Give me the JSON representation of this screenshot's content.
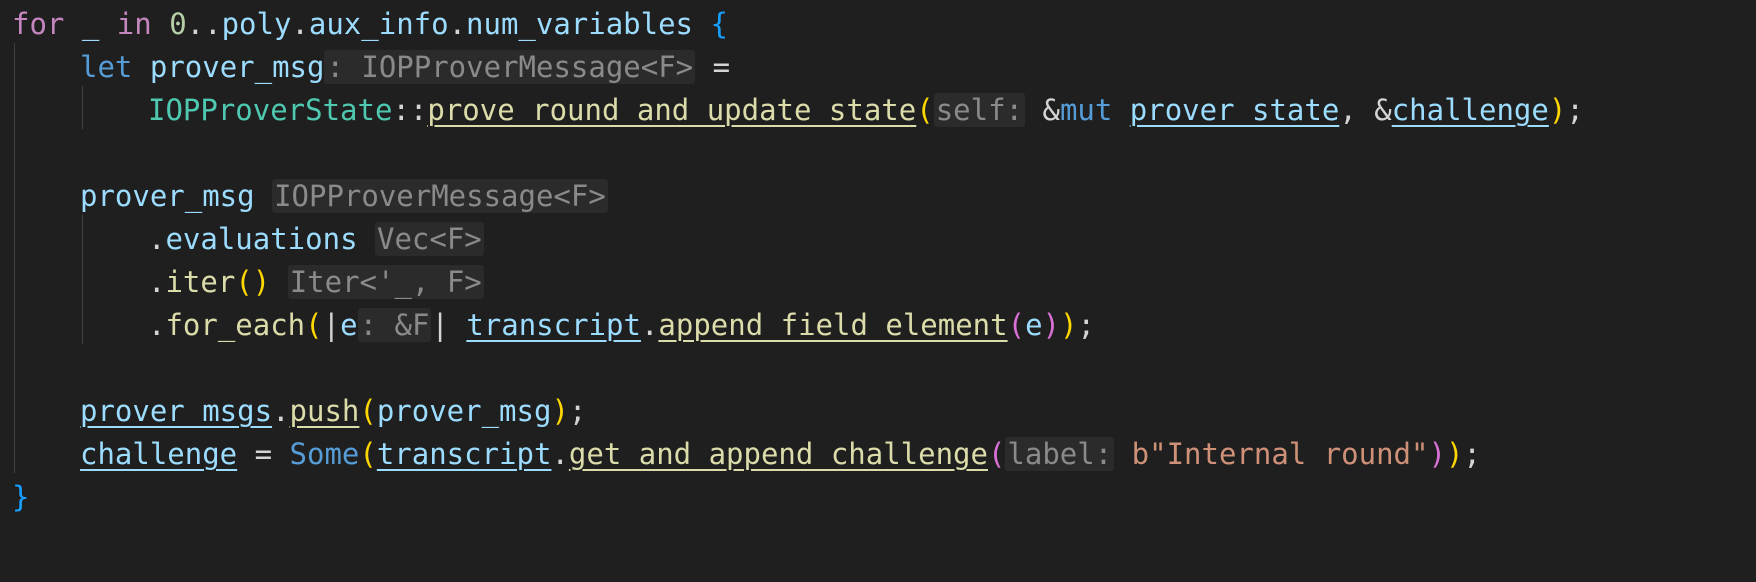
{
  "editor": {
    "lines": [
      {
        "indent": 0,
        "tokens": [
          {
            "t": "for",
            "c": "kw-ctrl"
          },
          {
            "t": " ",
            "c": "punc"
          },
          {
            "t": "_",
            "c": "var"
          },
          {
            "t": " ",
            "c": "punc"
          },
          {
            "t": "in",
            "c": "kw-ctrl"
          },
          {
            "t": " ",
            "c": "punc"
          },
          {
            "t": "0",
            "c": "num"
          },
          {
            "t": "..",
            "c": "punc"
          },
          {
            "t": "poly",
            "c": "var"
          },
          {
            "t": ".",
            "c": "punc"
          },
          {
            "t": "aux_info",
            "c": "var"
          },
          {
            "t": ".",
            "c": "punc"
          },
          {
            "t": "num_variables",
            "c": "var"
          },
          {
            "t": " ",
            "c": "punc"
          },
          {
            "t": "{",
            "c": "bracket3"
          }
        ]
      },
      {
        "indent": 1,
        "tokens": [
          {
            "t": "let",
            "c": "kw"
          },
          {
            "t": " ",
            "c": "punc"
          },
          {
            "t": "prover_msg",
            "c": "var"
          },
          {
            "t": ": IOPProverMessage<F>",
            "c": "hint"
          },
          {
            "t": " =",
            "c": "punc"
          }
        ]
      },
      {
        "indent": 2,
        "tokens": [
          {
            "t": "IOPProverState",
            "c": "type"
          },
          {
            "t": "::",
            "c": "punc"
          },
          {
            "t": "prove_round_and_update_state",
            "c": "fn u"
          },
          {
            "t": "(",
            "c": "bracket1"
          },
          {
            "t": "self:",
            "c": "hint"
          },
          {
            "t": " &",
            "c": "punc"
          },
          {
            "t": "mut",
            "c": "kw"
          },
          {
            "t": " ",
            "c": "punc"
          },
          {
            "t": "prover_state",
            "c": "var u"
          },
          {
            "t": ", &",
            "c": "punc"
          },
          {
            "t": "challenge",
            "c": "var u"
          },
          {
            "t": ")",
            "c": "bracket1"
          },
          {
            "t": ";",
            "c": "punc"
          }
        ]
      },
      {
        "indent": 0,
        "tokens": []
      },
      {
        "indent": 1,
        "tokens": [
          {
            "t": "prover_msg",
            "c": "var"
          },
          {
            "t": " ",
            "c": "punc"
          },
          {
            "t": "IOPProverMessage<F>",
            "c": "hint"
          }
        ]
      },
      {
        "indent": 2,
        "tokens": [
          {
            "t": ".",
            "c": "punc"
          },
          {
            "t": "evaluations",
            "c": "var"
          },
          {
            "t": " ",
            "c": "punc"
          },
          {
            "t": "Vec<F>",
            "c": "hint"
          }
        ]
      },
      {
        "indent": 2,
        "tokens": [
          {
            "t": ".",
            "c": "punc"
          },
          {
            "t": "iter",
            "c": "fn"
          },
          {
            "t": "()",
            "c": "bracket1"
          },
          {
            "t": " ",
            "c": "punc"
          },
          {
            "t": "Iter<'_, F>",
            "c": "hint"
          }
        ]
      },
      {
        "indent": 2,
        "tokens": [
          {
            "t": ".",
            "c": "punc"
          },
          {
            "t": "for_each",
            "c": "fn"
          },
          {
            "t": "(",
            "c": "bracket1"
          },
          {
            "t": "|",
            "c": "punc"
          },
          {
            "t": "e",
            "c": "var"
          },
          {
            "t": ": &F",
            "c": "hint"
          },
          {
            "t": "| ",
            "c": "punc"
          },
          {
            "t": "transcript",
            "c": "var u"
          },
          {
            "t": ".",
            "c": "punc"
          },
          {
            "t": "append_field_element",
            "c": "fn u"
          },
          {
            "t": "(",
            "c": "bracket2"
          },
          {
            "t": "e",
            "c": "var"
          },
          {
            "t": ")",
            "c": "bracket2"
          },
          {
            "t": ")",
            "c": "bracket1"
          },
          {
            "t": ";",
            "c": "punc"
          }
        ]
      },
      {
        "indent": 0,
        "tokens": []
      },
      {
        "indent": 1,
        "tokens": [
          {
            "t": "prover_msgs",
            "c": "var u"
          },
          {
            "t": ".",
            "c": "punc"
          },
          {
            "t": "push",
            "c": "fn u"
          },
          {
            "t": "(",
            "c": "bracket1"
          },
          {
            "t": "prover_msg",
            "c": "var"
          },
          {
            "t": ")",
            "c": "bracket1"
          },
          {
            "t": ";",
            "c": "punc"
          }
        ]
      },
      {
        "indent": 1,
        "tokens": [
          {
            "t": "challenge",
            "c": "var u"
          },
          {
            "t": " = ",
            "c": "punc"
          },
          {
            "t": "Some",
            "c": "kw"
          },
          {
            "t": "(",
            "c": "bracket1"
          },
          {
            "t": "transcript",
            "c": "var u"
          },
          {
            "t": ".",
            "c": "punc"
          },
          {
            "t": "get_and_append_challenge",
            "c": "fn u"
          },
          {
            "t": "(",
            "c": "bracket2"
          },
          {
            "t": "label:",
            "c": "hint"
          },
          {
            "t": " ",
            "c": "punc"
          },
          {
            "t": "b\"Internal round\"",
            "c": "str"
          },
          {
            "t": ")",
            "c": "bracket2"
          },
          {
            "t": ")",
            "c": "bracket1"
          },
          {
            "t": ";",
            "c": "punc"
          }
        ]
      },
      {
        "indent": 0,
        "tokens": [
          {
            "t": "}",
            "c": "bracket3"
          }
        ]
      }
    ]
  }
}
